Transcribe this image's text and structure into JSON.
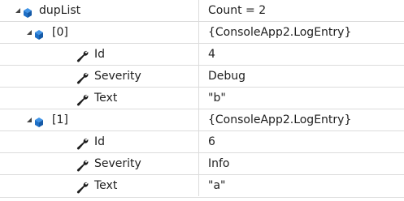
{
  "watch": {
    "rows": [
      {
        "name": "dupList",
        "value": "Count = 2"
      },
      {
        "name": "[0]",
        "value": "{ConsoleApp2.LogEntry}"
      },
      {
        "name": "Id",
        "value": "4"
      },
      {
        "name": "Severity",
        "value": "Debug"
      },
      {
        "name": "Text",
        "value": "\"b\""
      },
      {
        "name": "[1]",
        "value": "{ConsoleApp2.LogEntry}"
      },
      {
        "name": "Id",
        "value": "6"
      },
      {
        "name": "Severity",
        "value": "Info"
      },
      {
        "name": "Text",
        "value": "\"a\""
      }
    ]
  },
  "colors": {
    "object_icon": "#1e6fc6",
    "wrench_icon": "#1e1e1e",
    "grid_line": "#dcdcdc"
  },
  "icons": {
    "expander": "expanded-triangle-icon",
    "object": "object-icon",
    "property": "wrench-icon"
  }
}
